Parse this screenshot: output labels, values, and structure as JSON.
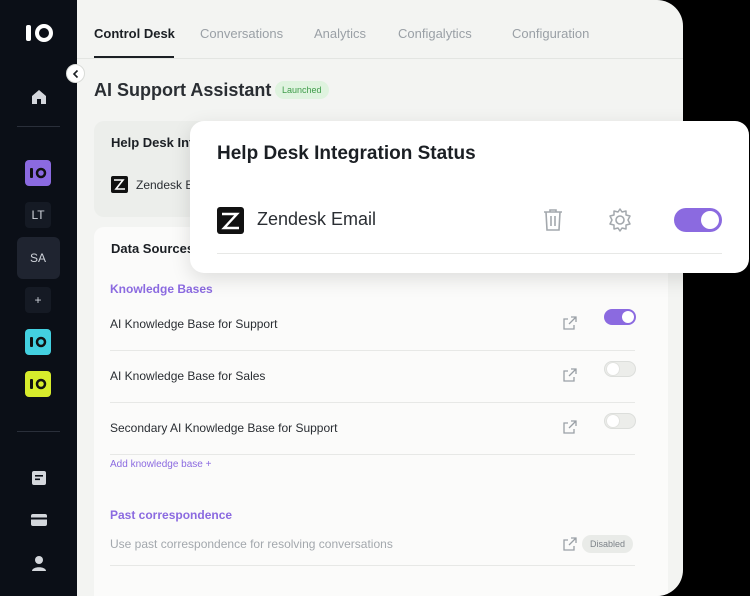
{
  "sidebar": {
    "workspaces": [
      {
        "label": "",
        "type": "logo",
        "color": "#8b6ae0"
      },
      {
        "label": "LT",
        "type": "text"
      },
      {
        "label": "SA",
        "type": "text"
      },
      {
        "label": "+",
        "type": "text"
      },
      {
        "label": "",
        "type": "logo",
        "color": "#43d0e0"
      },
      {
        "label": "",
        "type": "logo",
        "color": "#d7ec2c"
      }
    ]
  },
  "tabs": [
    "Control Desk",
    "Conversations",
    "Analytics",
    "Configalytics",
    "Configuration"
  ],
  "page": {
    "title": "AI Support Assistant",
    "status_badge": "Launched"
  },
  "help_desk_card": {
    "title": "Help Desk Int",
    "integration_label": "Zendesk E"
  },
  "data_sources": {
    "title": "Data Sources",
    "knowledge_bases_title": "Knowledge Bases",
    "items": [
      {
        "label": "AI Knowledge Base for Support",
        "enabled": true
      },
      {
        "label": "AI Knowledge Base for Sales",
        "enabled": false
      },
      {
        "label": "Secondary AI Knowledge Base for Support",
        "enabled": false
      }
    ],
    "add_label": "Add knowledge base  +",
    "past_title": "Past correspondence",
    "past_label": "Use past correspondence for resolving conversations",
    "past_badge": "Disabled"
  },
  "popup": {
    "title": "Help Desk Integration Status",
    "integration_label": "Zendesk Email",
    "enabled": true
  },
  "colors": {
    "accent": "#8b6ae0",
    "sidebar_bg": "#0b0f17",
    "launched_bg": "#dff3df",
    "launched_text": "#3f9c4a"
  }
}
